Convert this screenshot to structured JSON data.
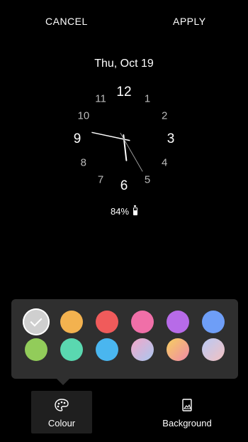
{
  "topbar": {
    "cancel_label": "CANCEL",
    "apply_label": "APPLY"
  },
  "date": "Thu, Oct 19",
  "clock": {
    "numbers": [
      "12",
      "1",
      "2",
      "3",
      "4",
      "5",
      "6",
      "7",
      "8",
      "9",
      "10",
      "11"
    ],
    "hour": 5,
    "minute": 47,
    "hand_color": "#ffffff"
  },
  "battery": {
    "percent_label": "84%",
    "level": 0.84,
    "icon": "battery-icon"
  },
  "palette": {
    "selected_index": 0,
    "swatches": [
      {
        "name": "white",
        "color": "#cfcfcf"
      },
      {
        "name": "orange",
        "color": "#f3b24f"
      },
      {
        "name": "red",
        "color": "#f05b5b"
      },
      {
        "name": "pink",
        "color": "#f06fa8"
      },
      {
        "name": "purple",
        "color": "#b76be8"
      },
      {
        "name": "blue",
        "color": "#6e9ef7"
      },
      {
        "name": "green",
        "color": "#92cc5a"
      },
      {
        "name": "teal",
        "color": "#5ad8b0"
      },
      {
        "name": "sky",
        "color": "#4ab6ef"
      },
      {
        "name": "gradient-pink-blue",
        "color": "linear-gradient(135deg,#f3a6c8,#a9c8f0)"
      },
      {
        "name": "gradient-orange-pink",
        "color": "linear-gradient(135deg,#f6cf5f,#f08aa8)"
      },
      {
        "name": "gradient-blue-pink",
        "color": "linear-gradient(135deg,#b8c9f5,#f3c1c1)"
      }
    ],
    "check_icon": "check-icon"
  },
  "bottombar": {
    "tabs": [
      {
        "label": "Colour",
        "icon": "palette-icon",
        "active": true
      },
      {
        "label": "Background",
        "icon": "image-icon",
        "active": false
      }
    ]
  }
}
